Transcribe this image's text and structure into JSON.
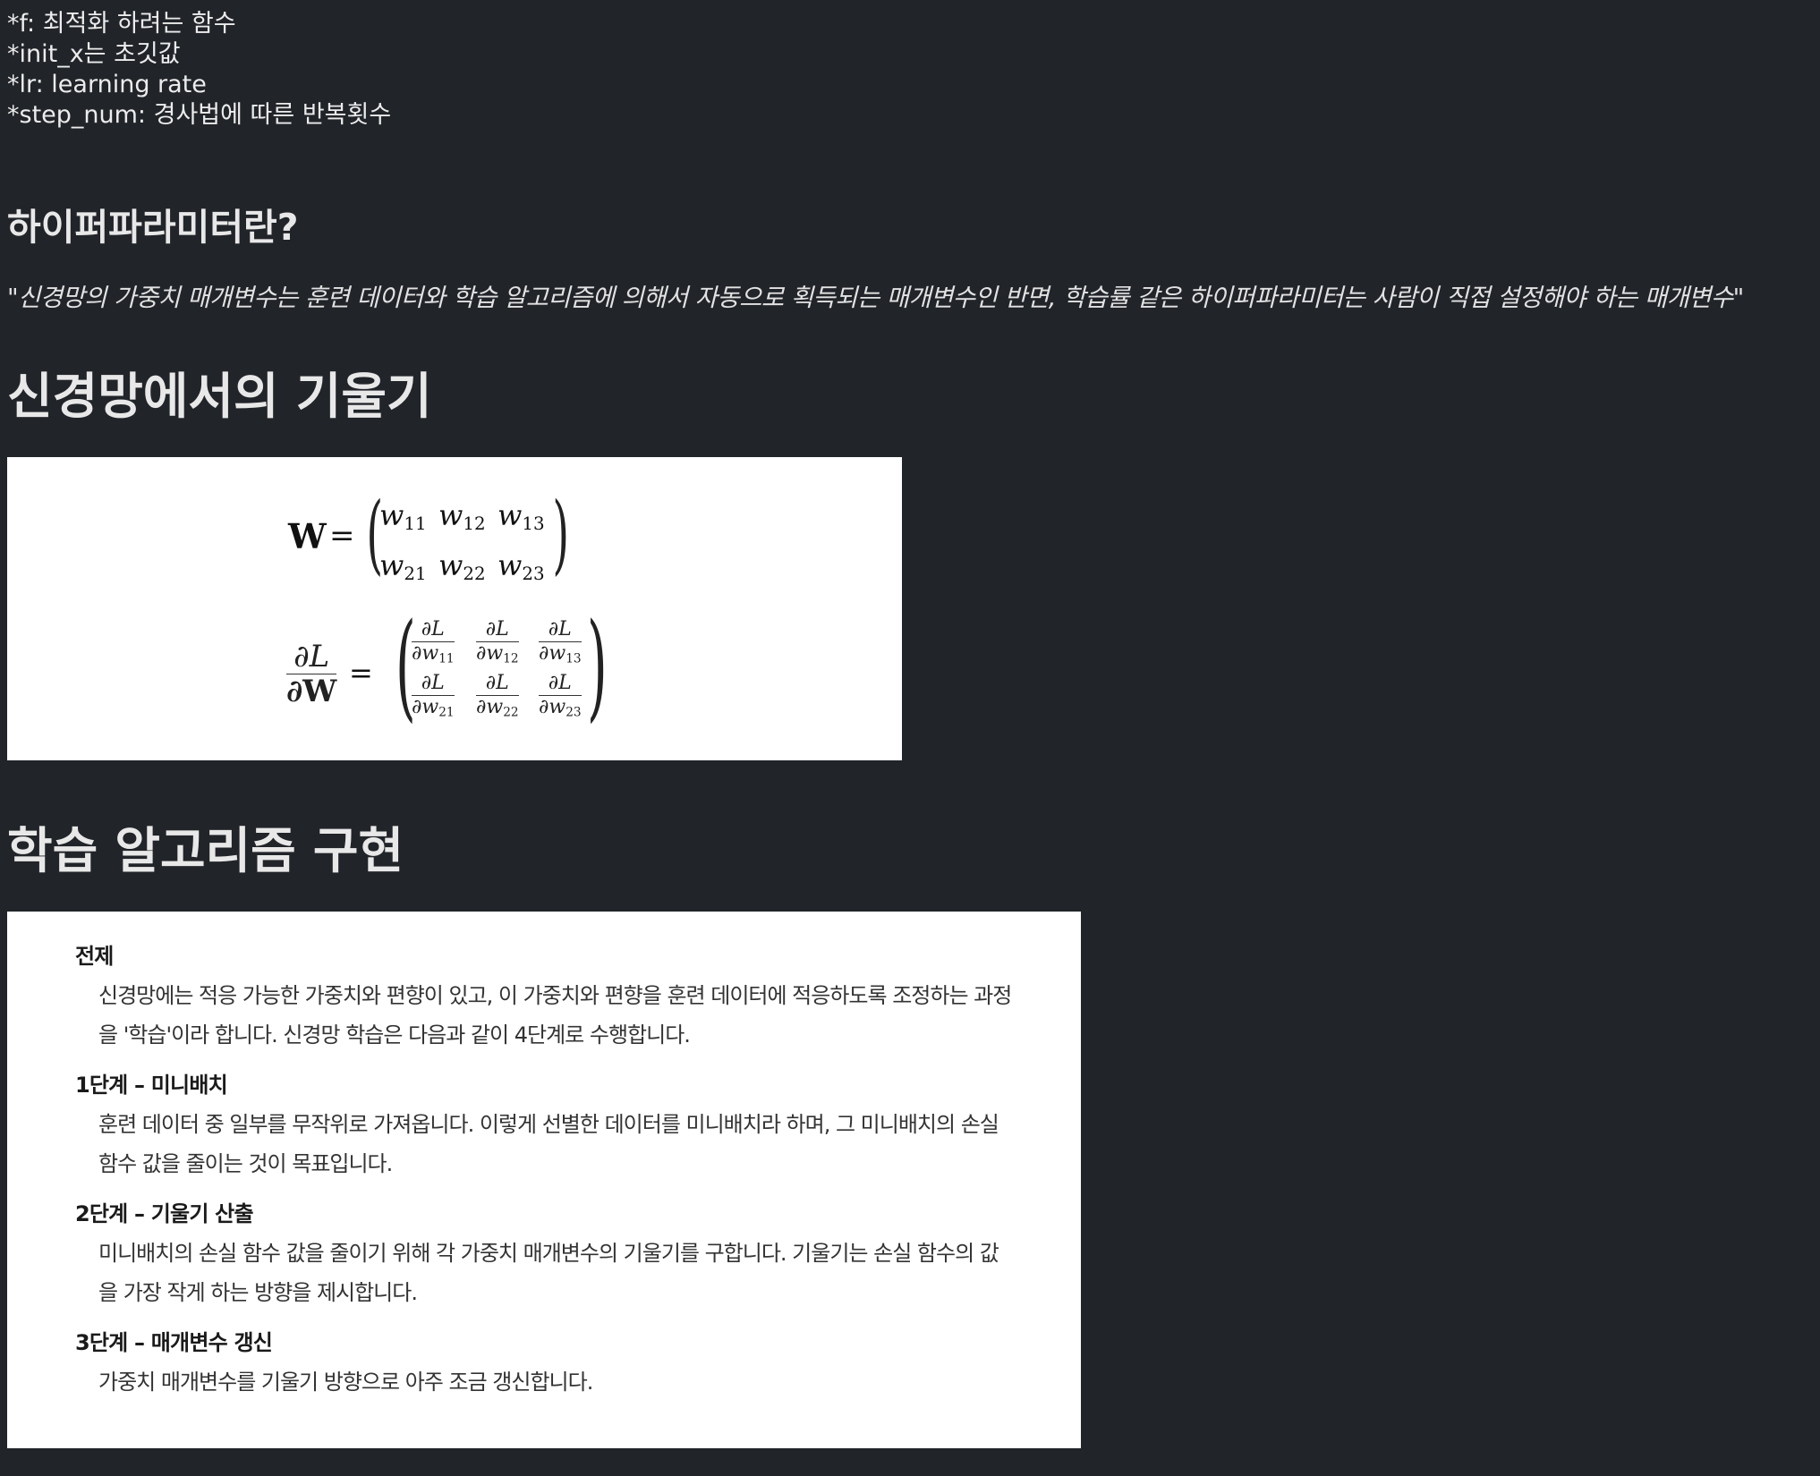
{
  "notes": [
    "*f: 최적화 하려는 함수",
    "*init_x는 초깃값",
    "*lr: learning rate",
    "*step_num: 경사법에 따른 반복횟수"
  ],
  "hyperparam_heading": "하이퍼파라미터란?",
  "hyperparam_quote": "\"신경망의 가중치 매개변수는 훈련 데이터와 학습 알고리즘에 의해서 자동으로 획득되는 매개변수인 반면, 학습률 같은 하이퍼파라미터는 사람이 직접 설정해야 하는 매개변수\"",
  "section_gradient_title": "신경망에서의 기울기",
  "math": {
    "W": "W",
    "eq": "=",
    "w_labels": [
      "w",
      "w",
      "w",
      "w",
      "w",
      "w"
    ],
    "w_subs": [
      "11",
      "12",
      "13",
      "21",
      "22",
      "23"
    ],
    "dL": "∂L",
    "dW": "∂W",
    "dw": "∂w"
  },
  "section_learning_title": "학습 알고리즘 구현",
  "learning": {
    "premise_title": "전제",
    "premise_line1": "신경망에는 적응 가능한 가중치와 편향이 있고, 이 가중치와 편향을 훈련 데이터에 적응하도록 조정하는 과정",
    "premise_line2": "을 '학습'이라 합니다. 신경망 학습은 다음과 같이 4단계로 수행합니다.",
    "step1_title": "1단계 – 미니배치",
    "step1_line1": "훈련 데이터 중 일부를 무작위로 가져옵니다. 이렇게 선별한 데이터를 미니배치라 하며, 그 미니배치의 손실",
    "step1_line2": "함수 값을 줄이는 것이 목표입니다.",
    "step2_title": "2단계 – 기울기 산출",
    "step2_line1": "미니배치의 손실 함수 값을 줄이기 위해 각 가중치 매개변수의 기울기를 구합니다. 기울기는 손실 함수의 값",
    "step2_line2": "을 가장 작게 하는 방향을 제시합니다.",
    "step3_title": "3단계 – 매개변수 갱신",
    "step3_line1": "가중치 매개변수를 기울기 방향으로 아주 조금 갱신합니다."
  }
}
